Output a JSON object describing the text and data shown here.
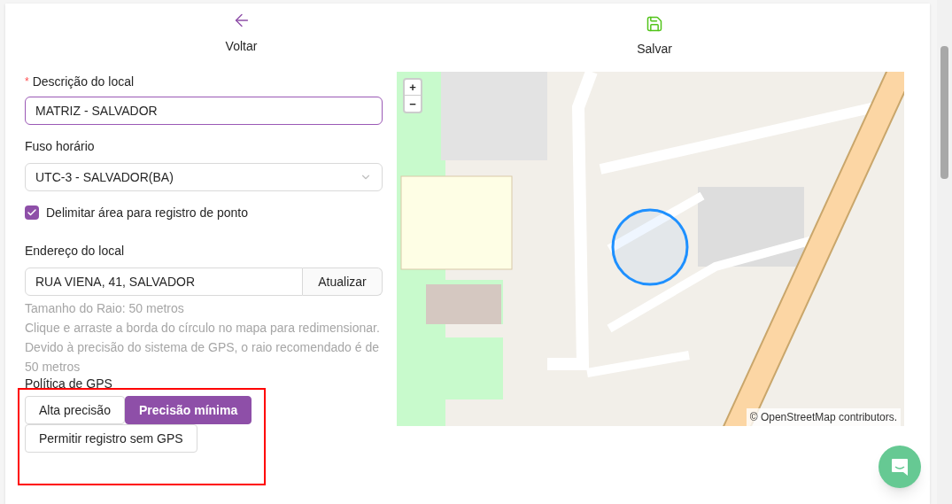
{
  "header": {
    "back": {
      "label": "Voltar"
    },
    "save": {
      "label": "Salvar"
    }
  },
  "form": {
    "description": {
      "label": "Descrição do local",
      "required_mark": "*",
      "value": "MATRIZ - SALVADOR"
    },
    "timezone": {
      "label": "Fuso horário",
      "value": "UTC-3 - SALVADOR(BA)"
    },
    "delimit": {
      "label": "Delimitar área para registro de ponto",
      "checked": true
    },
    "address": {
      "label": "Endereço do local",
      "value": "RUA VIENA, 41, SALVADOR",
      "button": "Atualizar"
    },
    "hints": [
      "Tamanho do Raio: 50 metros",
      "Clique e arraste a borda do círculo no mapa para redimensionar.",
      "Devido à precisão do sistema de GPS, o raio recomendado é de 50 metros"
    ],
    "gps_policy": {
      "label": "Política de GPS",
      "options": [
        {
          "label": "Alta precisão",
          "selected": false
        },
        {
          "label": "Precisão mínima",
          "selected": true
        },
        {
          "label": "Permitir registro sem GPS",
          "selected": false
        }
      ]
    }
  },
  "map": {
    "zoom_in": "+",
    "zoom_out": "−",
    "attribution": "© OpenStreetMap contributors."
  }
}
